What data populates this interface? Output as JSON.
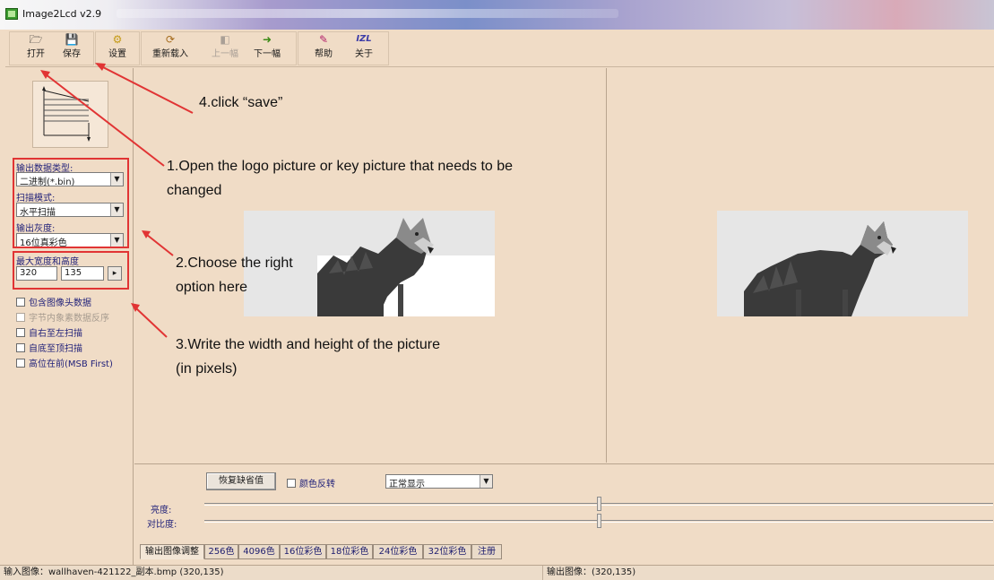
{
  "window": {
    "title": "Image2Lcd v2.9",
    "title_colors": {
      "accent": "#3a9a2e"
    }
  },
  "toolbar": {
    "buttons": [
      {
        "label": "打开",
        "icon": "open-icon",
        "glyph": "🗁"
      },
      {
        "label": "保存",
        "icon": "save-icon",
        "glyph": "💾"
      },
      {
        "label": "设置",
        "icon": "settings-icon",
        "glyph": "⚙"
      },
      {
        "label": "重新载入",
        "icon": "reload-icon",
        "glyph": "⟳"
      },
      {
        "label": "上一幅",
        "icon": "previous-icon",
        "glyph": "◧"
      },
      {
        "label": "下一幅",
        "icon": "next-icon",
        "glyph": "➜"
      },
      {
        "label": "帮助",
        "icon": "help-icon",
        "glyph": "✎"
      },
      {
        "label": "关于",
        "icon": "about-icon",
        "glyph": "IZL"
      }
    ]
  },
  "left_panel": {
    "output_type_label": "输出数据类型:",
    "output_type_value": "二进制(*.bin)",
    "scan_mode_label": "扫描模式:",
    "scan_mode_value": "水平扫描",
    "gray_label": "输出灰度:",
    "gray_value": "16位真彩色",
    "max_size_label": "最大宽度和高度",
    "max_width": "320",
    "max_height": "135",
    "checkboxes": [
      {
        "label": "包含图像头数据",
        "checked": false,
        "enabled": true
      },
      {
        "label": "字节内象素数据反序",
        "checked": false,
        "enabled": false
      },
      {
        "label": "自右至左扫描",
        "checked": false,
        "enabled": true
      },
      {
        "label": "自底至顶扫描",
        "checked": false,
        "enabled": true
      },
      {
        "label": "高位在前(MSB First)",
        "checked": false,
        "enabled": true
      }
    ]
  },
  "annotations": {
    "step4": "4.click “save”",
    "step1_line1": "1.Open the logo picture or key picture that needs to be",
    "step1_line2": "changed",
    "step2_line1": "2.Choose the right",
    "step2_line2": "option here",
    "step3_line1": "3.Write the width and height of the picture",
    "step3_line2": "(in pixels)",
    "arrow_color": "#e13434"
  },
  "bottom_panel": {
    "reset_button": "恢复缺省值",
    "invert_label": "颜色反转",
    "display_mode": "正常显示",
    "brightness_label": "亮度:",
    "contrast_label": "对比度:",
    "brightness_value": 0.5,
    "contrast_value": 0.5,
    "tabs": [
      "输出图像调整",
      "256色",
      "4096色",
      "16位彩色",
      "18位彩色",
      "24位彩色",
      "32位彩色",
      "注册"
    ]
  },
  "status": {
    "input": "输入图像：wallhaven-421122_副本.bmp (320,135)",
    "output": "输出图像：(320,135)"
  }
}
